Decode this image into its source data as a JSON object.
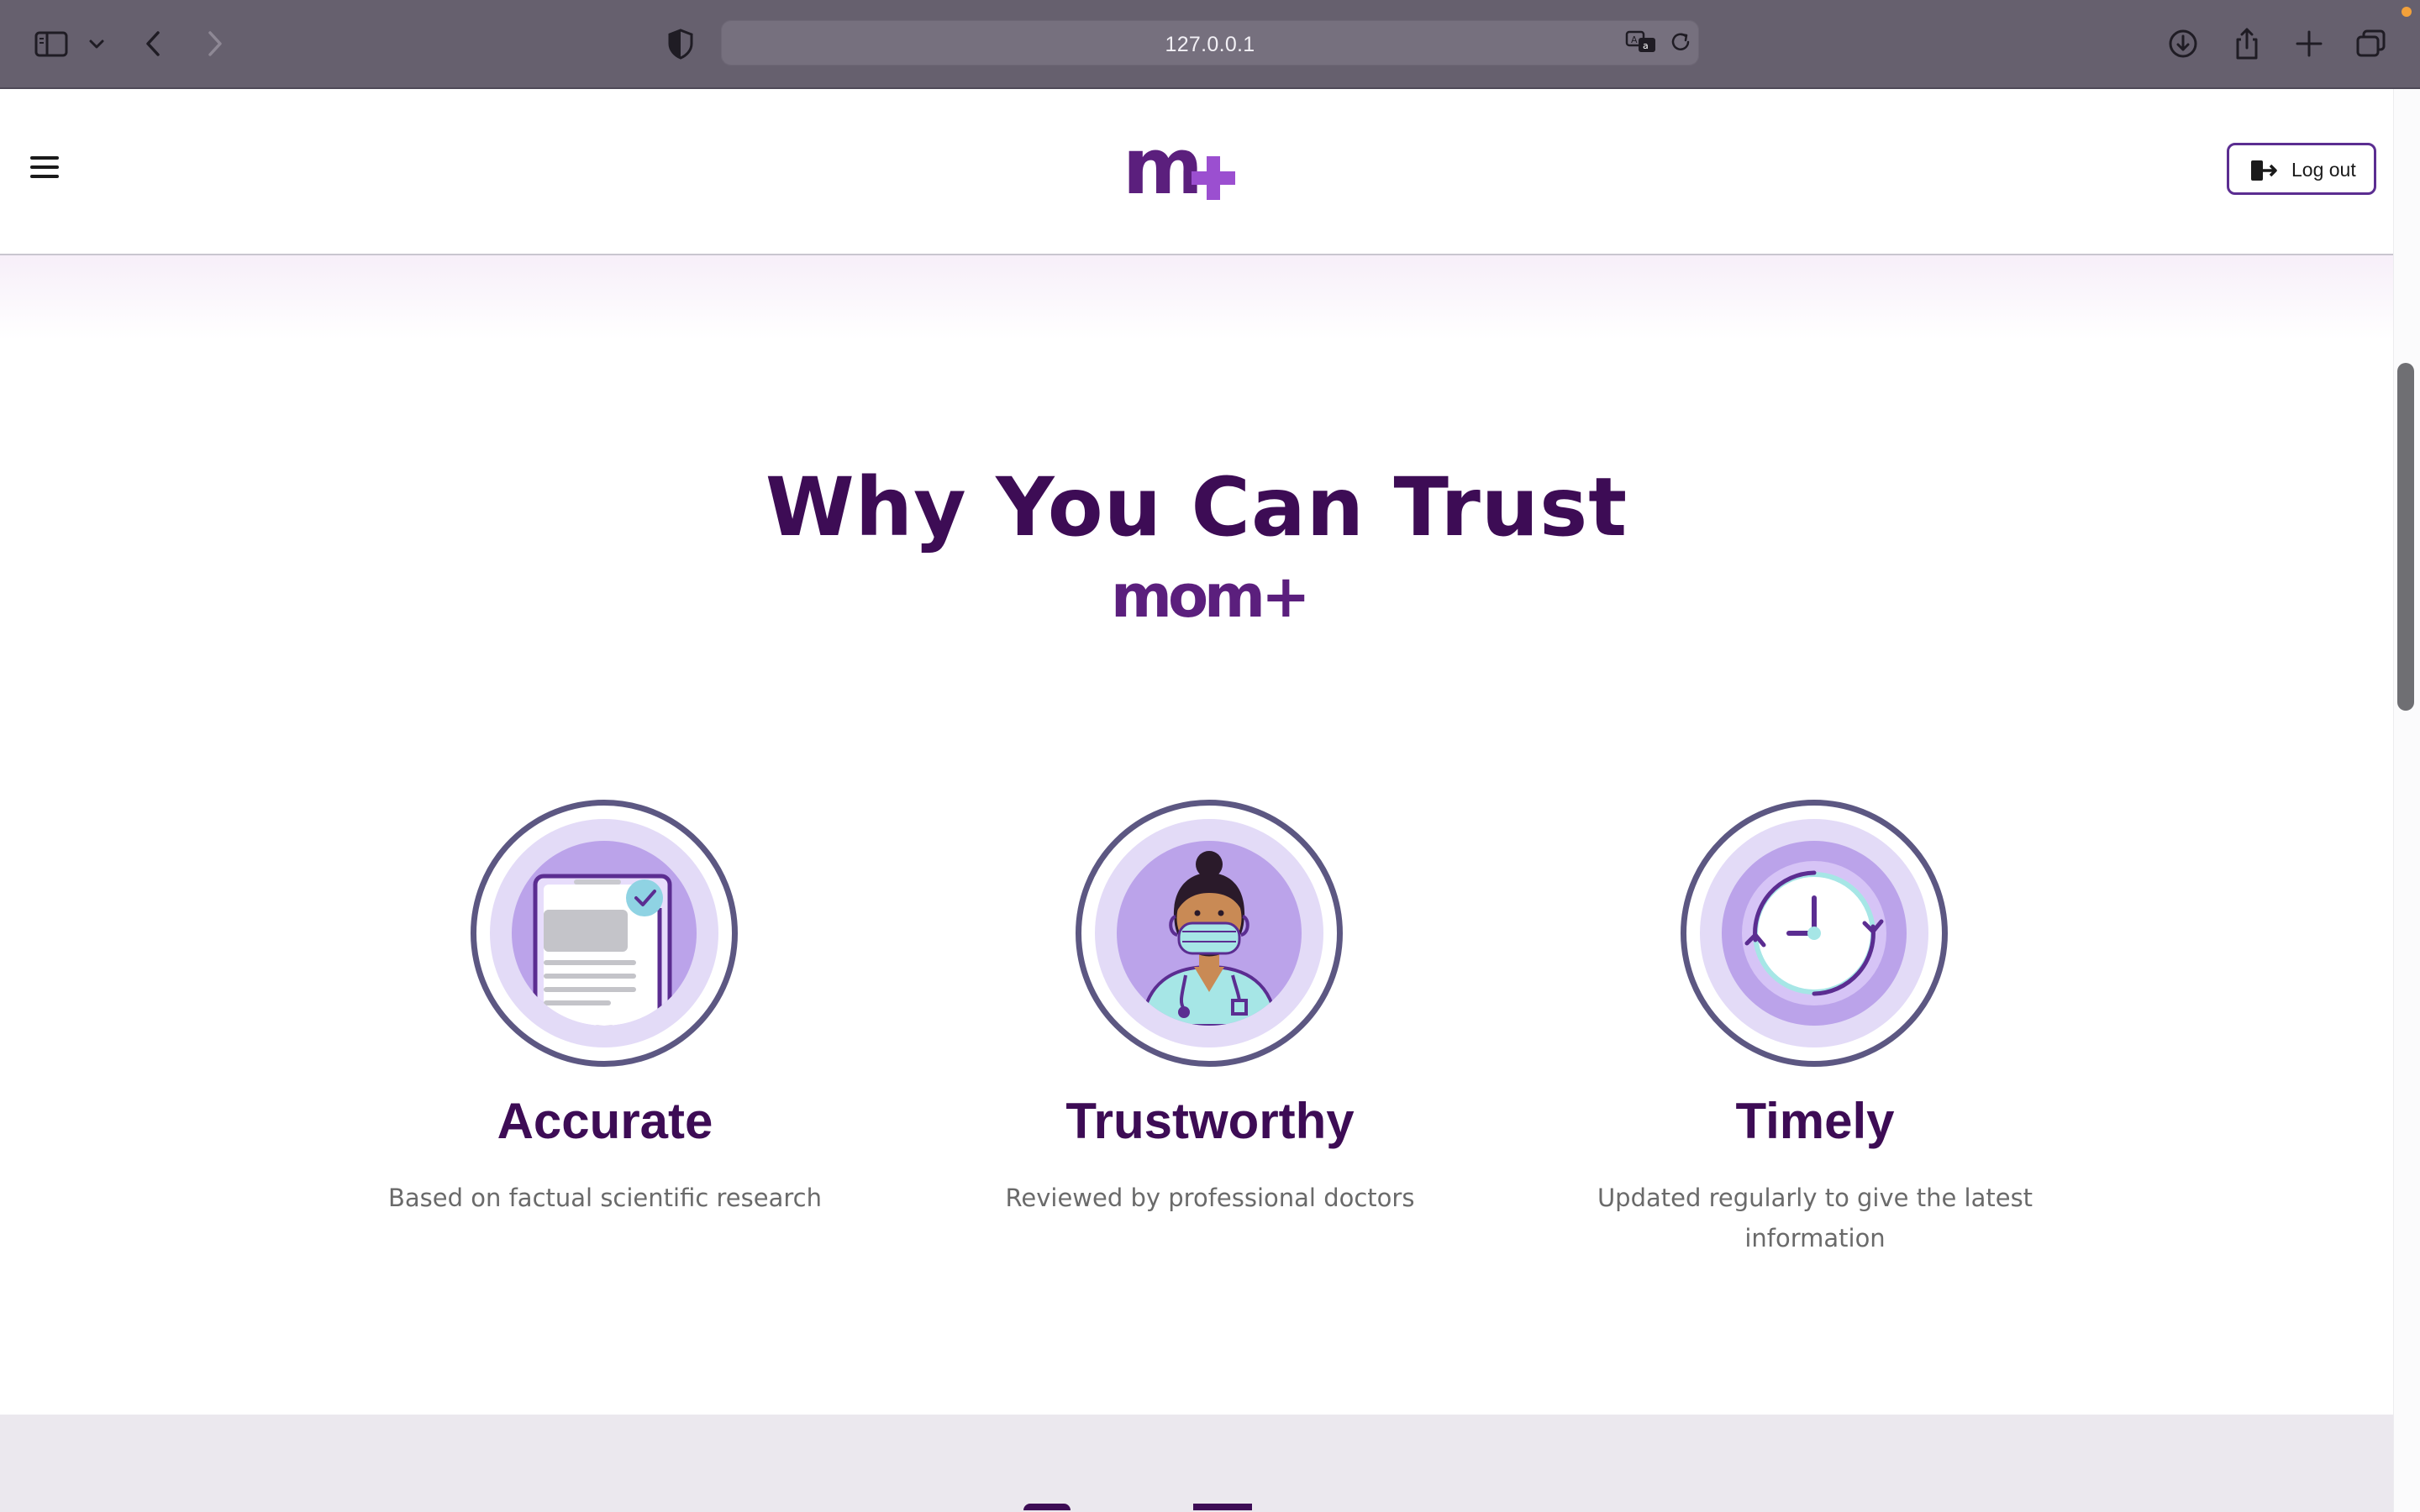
{
  "browser": {
    "url": "127.0.0.1",
    "icons": {
      "sidebar": "sidebar-icon",
      "sidebar_menu": "chevron-down-icon",
      "back": "chevron-left-icon",
      "forward": "chevron-right-icon",
      "privacy": "shield-icon",
      "translate": "translate-icon",
      "reload": "reload-icon",
      "downloads": "download-icon",
      "share": "share-icon",
      "new_tab": "plus-icon",
      "tabs_overview": "tabs-icon"
    }
  },
  "header": {
    "logo_text": "m+",
    "logout_label": "Log out"
  },
  "trust": {
    "title": "Why You Can Trust",
    "brand": "mom+",
    "features": [
      {
        "title": "Accurate",
        "description": "Based on factual scientific research",
        "icon": "document-check-icon"
      },
      {
        "title": "Trustworthy",
        "description": "Reviewed by professional doctors",
        "icon": "doctor-icon"
      },
      {
        "title": "Timely",
        "description": "Updated regularly to give the latest information",
        "icon": "clock-refresh-icon"
      }
    ]
  },
  "colors": {
    "brand_dark": "#3d0c55",
    "brand_purple": "#5b2d91",
    "brand_plus": "#9b4fd0",
    "chrome": "#66606e"
  }
}
